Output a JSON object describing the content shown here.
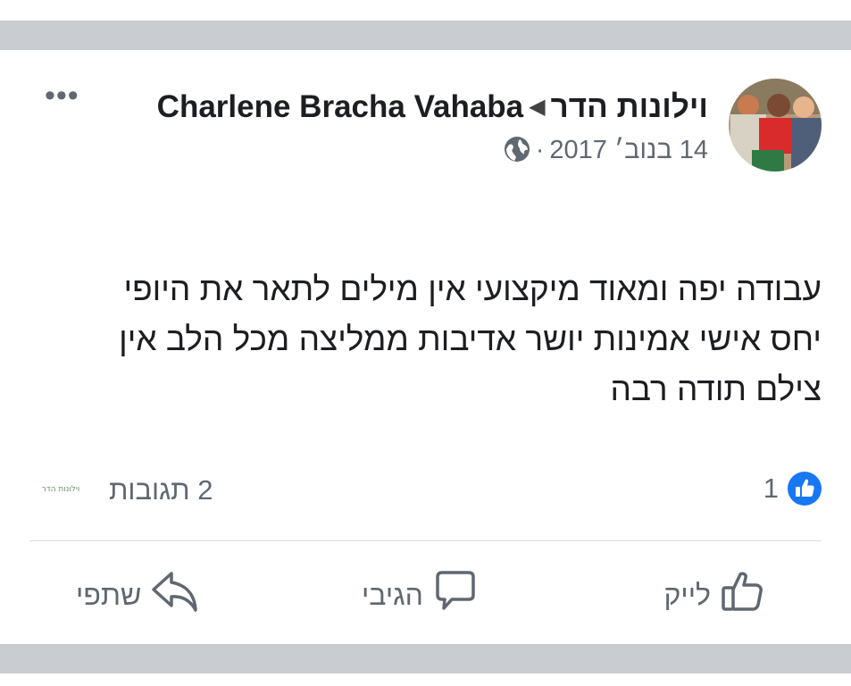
{
  "post": {
    "author_name": "וילונות הדר",
    "arrow": "◀",
    "target_page": "Charlene Bracha Vahaba",
    "date": "14 בנוב׳ 2017",
    "separator": "·",
    "privacy_icon": "globe-icon",
    "menu_label": "•••",
    "text": "עבודה יפה ומאוד מיקצועי אין מילים לתאר את היופי\nיחס אישי אמינות יושר אדיבות ממליצה מכל הלב אין\nצילם תודה רבה"
  },
  "engagement": {
    "reaction_icon": "like-icon",
    "reaction_count": "1",
    "comments_label": "2 תגובות",
    "commenter_logo_text": "וילונות הדר"
  },
  "actions": {
    "like_label": "לייק",
    "comment_label": "הגיבי",
    "share_label": "שתפי"
  },
  "colors": {
    "facebook_blue": "#1877f2",
    "separator_gray": "#c9ccd1",
    "secondary_text": "#606770"
  }
}
